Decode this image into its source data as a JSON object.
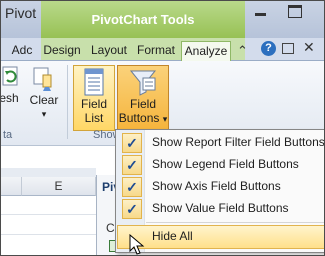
{
  "title_bar": {
    "doc_title": "Pivot Filt...",
    "context_tab_group": "PivotChart Tools"
  },
  "tabs": [
    {
      "label": "Adc"
    },
    {
      "label": "Design"
    },
    {
      "label": "Layout"
    },
    {
      "label": "Format"
    },
    {
      "label": "Analyze"
    }
  ],
  "ribbon": {
    "refresh_label": "esh",
    "clear_label": "Clear",
    "clear_arrow": "▾",
    "data_group_label": "ta",
    "field_list_line1": "Field",
    "field_list_line2": "List",
    "field_buttons_line1": "Field",
    "field_buttons_line2": "Buttons",
    "field_buttons_arrow": "▾",
    "show_group_label": "Show"
  },
  "sheet": {
    "column_e": "E",
    "pivot_pane_text": "Piv",
    "pivot_pane_text2": "Ch"
  },
  "menu": {
    "items": [
      {
        "label": "Show Report Filter Field Buttons",
        "checked": true
      },
      {
        "label": "Show Legend Field Buttons",
        "checked": true
      },
      {
        "label": "Show Axis Field Buttons",
        "checked": true
      },
      {
        "label": "Show Value Field Buttons",
        "checked": true
      },
      {
        "label": "Hide All",
        "checked": false
      }
    ],
    "check_glyph": "✓"
  },
  "colors": {
    "context_tab_green": "#97c154",
    "menu_hover": "#ffe08a",
    "check_blue": "#1f4d94"
  }
}
